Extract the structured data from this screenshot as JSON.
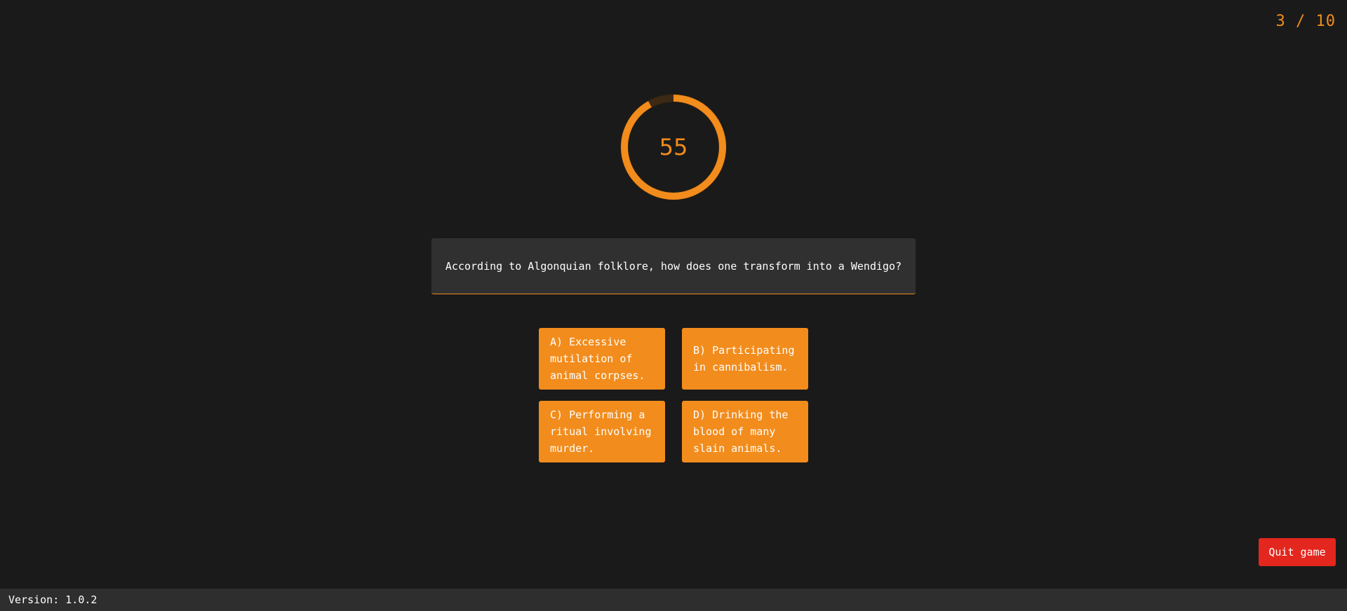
{
  "progress": {
    "current": 3,
    "total": 10,
    "label": "3 / 10"
  },
  "timer": {
    "value": "55",
    "remaining_fraction": 0.92,
    "ring_color": "#f28c1c",
    "track_color": "#3d2a14"
  },
  "question": {
    "text": "According to Algonquian folklore, how does one transform into a Wendigo?"
  },
  "answers": [
    {
      "label": "A) Excessive mutilation of animal corpses."
    },
    {
      "label": "B) Participating in cannibalism."
    },
    {
      "label": "C) Performing a ritual involving murder."
    },
    {
      "label": "D) Drinking the blood of many slain animals."
    }
  ],
  "quit": {
    "label": "Quit game"
  },
  "footer": {
    "version_label": "Version: 1.0.2"
  },
  "colors": {
    "accent": "#f28c1c",
    "danger": "#e3271e",
    "background": "#1a1a1a",
    "panel": "#303030"
  }
}
